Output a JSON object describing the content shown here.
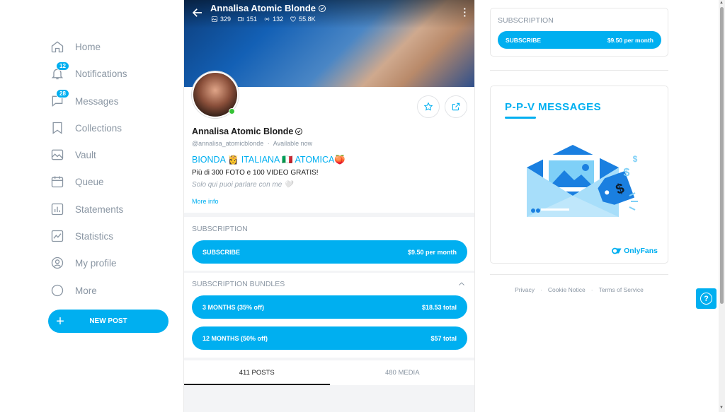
{
  "sidebar": {
    "items": [
      {
        "label": "Home",
        "icon": "home-icon"
      },
      {
        "label": "Notifications",
        "icon": "bell-icon",
        "badge": "12"
      },
      {
        "label": "Messages",
        "icon": "chat-icon",
        "badge": "28"
      },
      {
        "label": "Collections",
        "icon": "bookmark-icon"
      },
      {
        "label": "Vault",
        "icon": "image-icon"
      },
      {
        "label": "Queue",
        "icon": "calendar-icon"
      },
      {
        "label": "Statements",
        "icon": "bar-chart-icon"
      },
      {
        "label": "Statistics",
        "icon": "line-chart-icon"
      },
      {
        "label": "My profile",
        "icon": "user-circle-icon"
      },
      {
        "label": "More",
        "icon": "more-circle-icon"
      }
    ],
    "new_post_label": "NEW POST"
  },
  "profile": {
    "header_name": "Annalisa Atomic Blonde",
    "stats": {
      "photos": "329",
      "videos": "151",
      "streams": "132",
      "likes": "55.8K"
    },
    "name": "Annalisa Atomic Blonde",
    "handle": "@annalisa_atomicblonde",
    "availability": "Available now",
    "bio_line1": "BIONDA 👸 ITALIANA 🇮🇹 ATOMICA🍑",
    "bio_line2": "Più di 300 FOTO e 100 VIDEO GRATIS!",
    "bio_line3": "Solo qui puoi parlare con me 🤍",
    "more_info": "More info"
  },
  "subscription": {
    "heading": "SUBSCRIPTION",
    "button_label": "SUBSCRIBE",
    "price": "$9.50 per month"
  },
  "bundles": {
    "heading": "SUBSCRIPTION BUNDLES",
    "items": [
      {
        "label": "3 MONTHS (35% off)",
        "price": "$18.53 total"
      },
      {
        "label": "12 MONTHS (50% off)",
        "price": "$57 total"
      }
    ]
  },
  "tabs": [
    {
      "label": "411 POSTS",
      "active": true
    },
    {
      "label": "480 MEDIA",
      "active": false
    }
  ],
  "right": {
    "subscription_heading": "SUBSCRIPTION",
    "subscribe_label": "SUBSCRIBE",
    "subscribe_price": "$9.50 per month",
    "promo_title": "P-P-V  MESSAGES",
    "brand": "OnlyFans",
    "footer": [
      "Privacy",
      "Cookie Notice",
      "Terms of Service"
    ]
  },
  "colors": {
    "accent": "#00aff0",
    "muted": "#8a96a3",
    "online": "#35c235"
  }
}
